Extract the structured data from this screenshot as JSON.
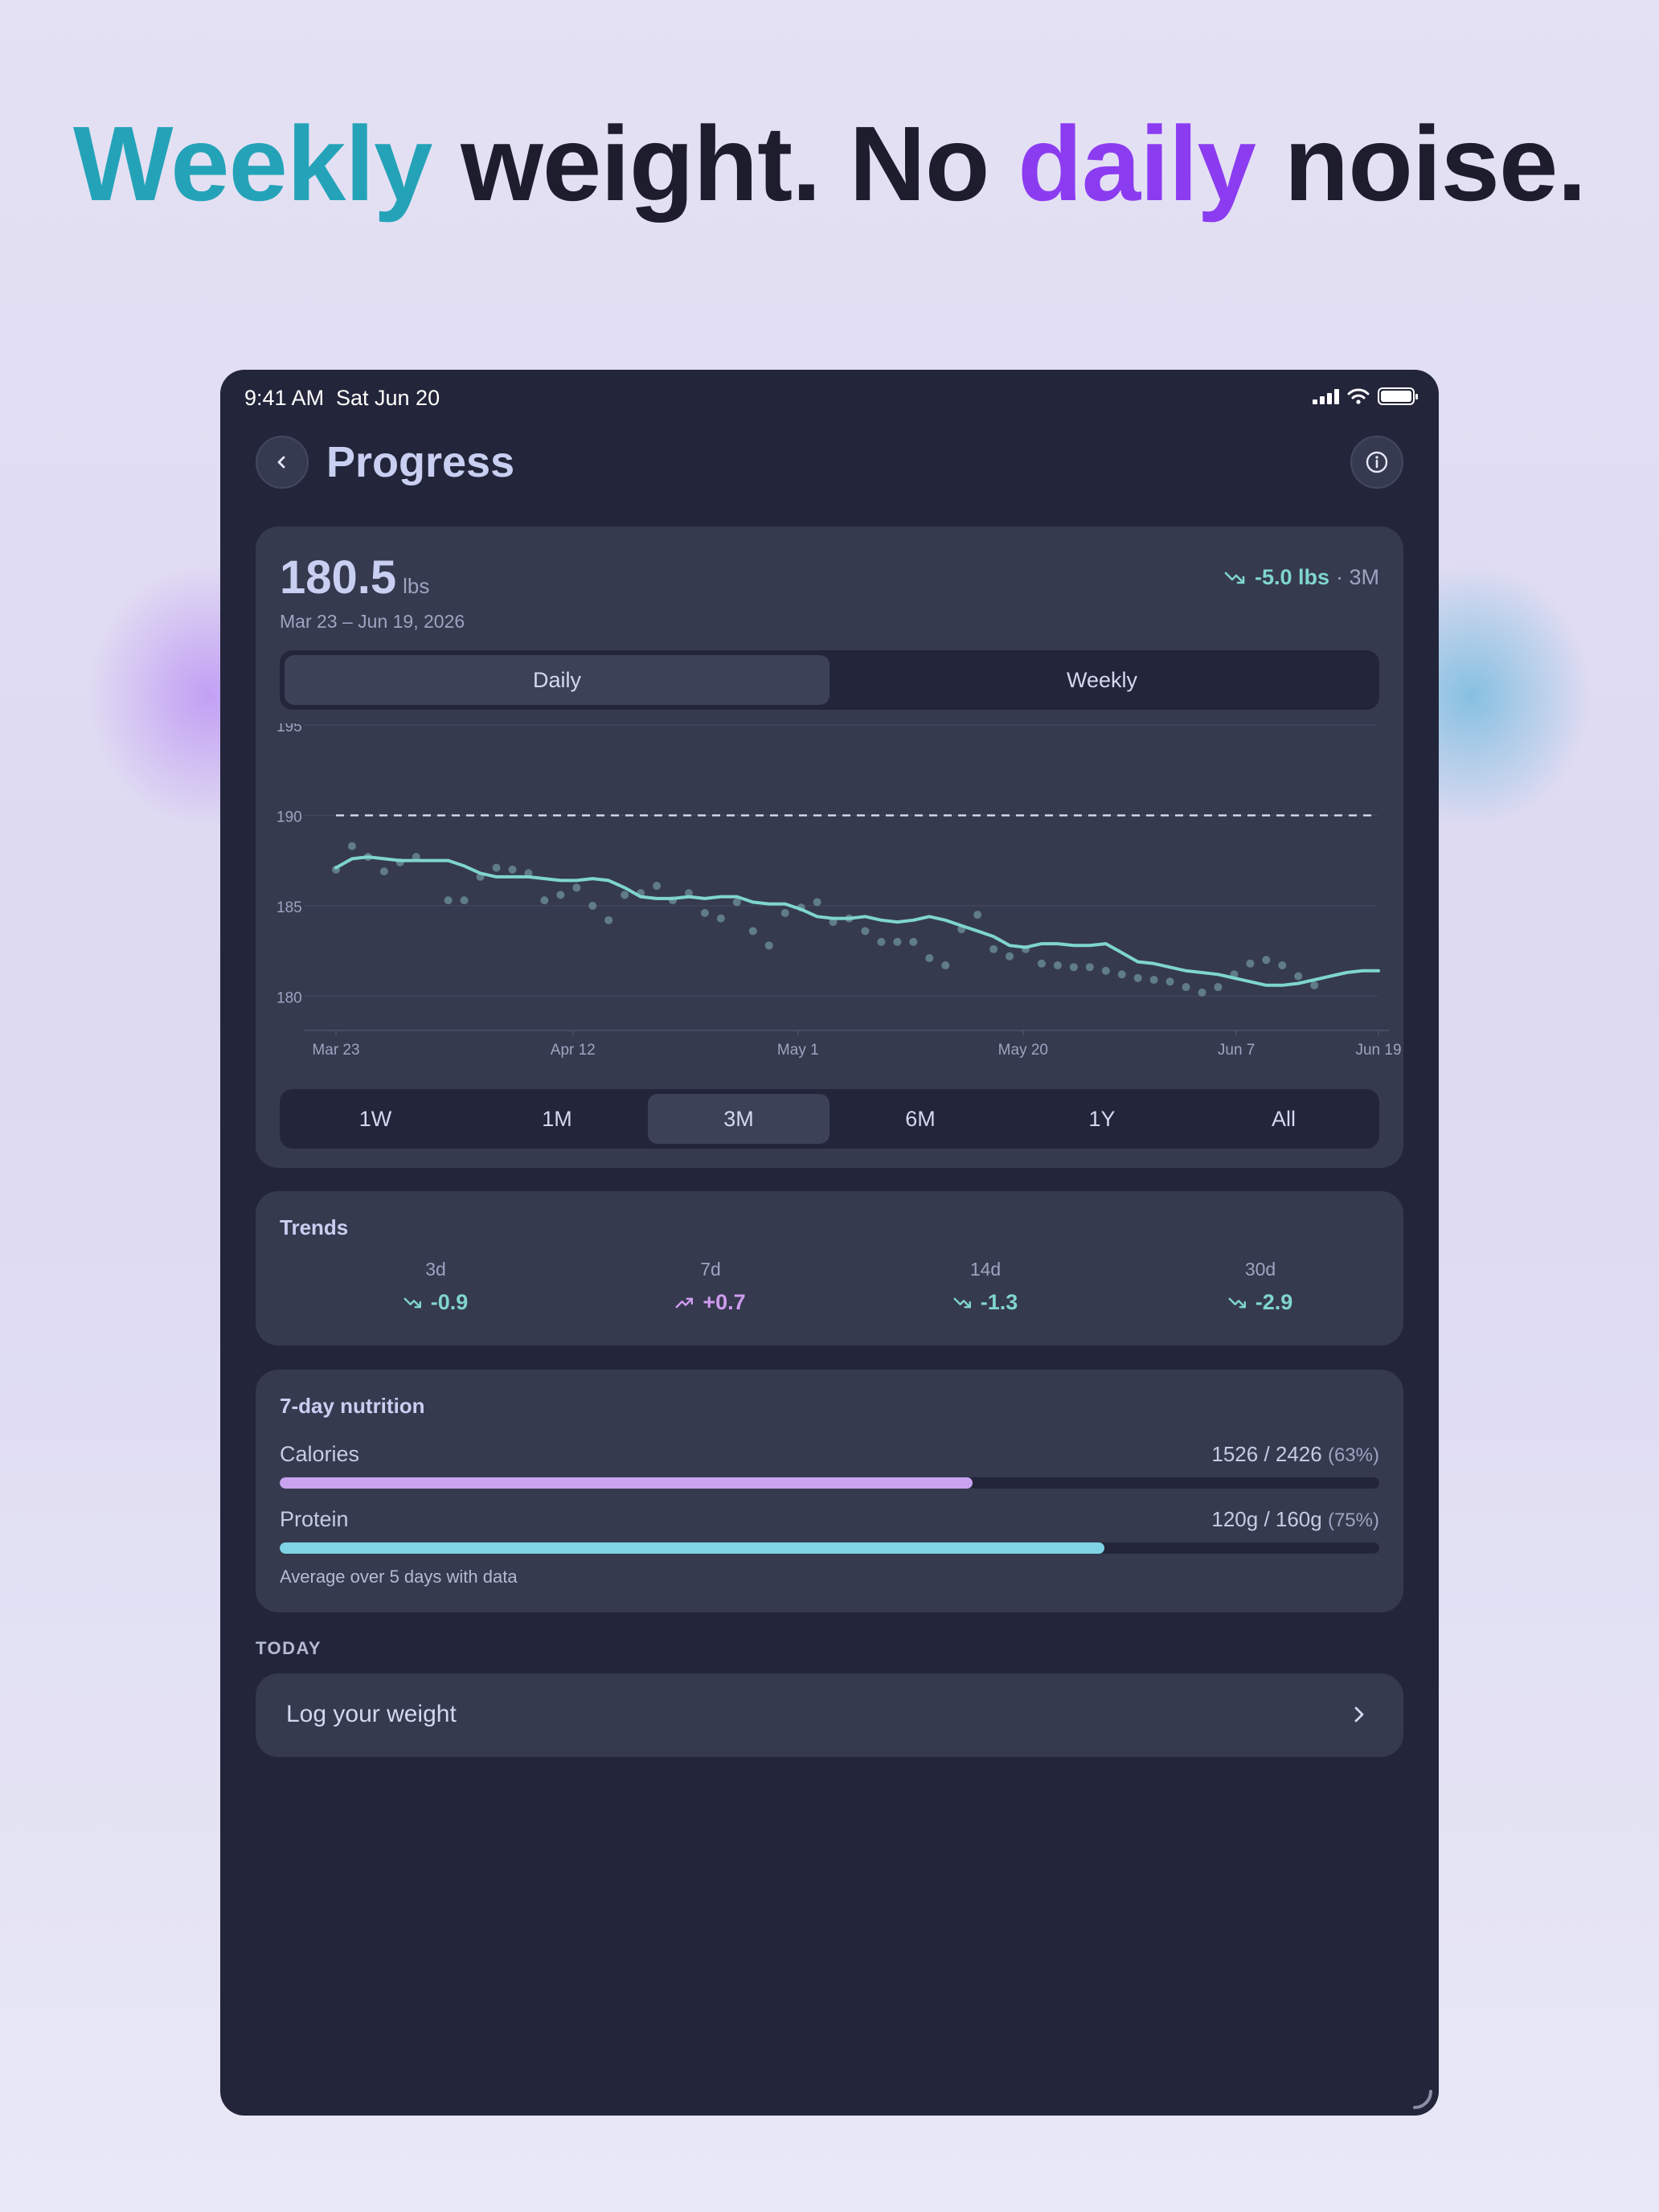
{
  "headline": {
    "word1": "Weekly",
    "word2": "weight. No",
    "word3": "daily",
    "word4": "noise."
  },
  "status_bar": {
    "time": "9:41 AM",
    "date": "Sat Jun 20",
    "icons": [
      "signal-icon",
      "wifi-icon",
      "battery-icon"
    ]
  },
  "header": {
    "back_icon": "chevron-left-icon",
    "title": "Progress",
    "info_icon": "info-icon"
  },
  "summary": {
    "weight": "180.5",
    "unit": "lbs",
    "date_range": "Mar 23 – Jun 19, 2026",
    "change": "-5.0 lbs",
    "change_period": "· 3M",
    "change_icon": "trending-down-icon"
  },
  "view_toggle": {
    "options": [
      "Daily",
      "Weekly"
    ],
    "selected": "Daily"
  },
  "range_selector": {
    "options": [
      "1W",
      "1M",
      "3M",
      "6M",
      "1Y",
      "All"
    ],
    "selected": "3M"
  },
  "chart_data": {
    "type": "line",
    "title": "",
    "xlabel": "",
    "ylabel": "",
    "x_start": "Mar 23",
    "x_end": "Jun 19",
    "x_tick_labels": [
      "Mar 23",
      "Apr 12",
      "May 1",
      "May 20",
      "Jun 7",
      "Jun 19"
    ],
    "y_tick_labels": [
      "195",
      "190",
      "185",
      "180"
    ],
    "ylim": [
      178.1,
      195
    ],
    "grid": true,
    "goal_line": 190,
    "series": [
      {
        "kind": "trend-line",
        "color": "#7fd6cc",
        "points": [
          [
            0,
            187.1
          ],
          [
            1,
            187.6
          ],
          [
            2,
            187.7
          ],
          [
            3,
            187.6
          ],
          [
            4,
            187.5
          ],
          [
            5,
            187.5
          ],
          [
            6,
            187.5
          ],
          [
            7,
            187.5
          ],
          [
            8,
            187.2
          ],
          [
            9,
            186.8
          ],
          [
            10,
            186.6
          ],
          [
            11,
            186.6
          ],
          [
            12,
            186.6
          ],
          [
            13,
            186.5
          ],
          [
            14,
            186.4
          ],
          [
            15,
            186.4
          ],
          [
            16,
            186.5
          ],
          [
            17,
            186.4
          ],
          [
            18,
            186.0
          ],
          [
            19,
            185.5
          ],
          [
            20,
            185.4
          ],
          [
            21,
            185.4
          ],
          [
            22,
            185.5
          ],
          [
            23,
            185.4
          ],
          [
            24,
            185.5
          ],
          [
            25,
            185.5
          ],
          [
            26,
            185.2
          ],
          [
            27,
            185.1
          ],
          [
            28,
            185.1
          ],
          [
            29,
            184.8
          ],
          [
            30,
            184.4
          ],
          [
            31,
            184.3
          ],
          [
            32,
            184.3
          ],
          [
            33,
            184.4
          ],
          [
            34,
            184.2
          ],
          [
            35,
            184.1
          ],
          [
            36,
            184.2
          ],
          [
            37,
            184.4
          ],
          [
            38,
            184.2
          ],
          [
            39,
            183.9
          ],
          [
            40,
            183.6
          ],
          [
            41,
            183.3
          ],
          [
            42,
            182.8
          ],
          [
            43,
            182.7
          ],
          [
            44,
            182.9
          ],
          [
            45,
            182.9
          ],
          [
            46,
            182.8
          ],
          [
            47,
            182.8
          ],
          [
            48,
            182.9
          ],
          [
            49,
            182.4
          ],
          [
            50,
            181.9
          ],
          [
            51,
            181.8
          ],
          [
            52,
            181.6
          ],
          [
            53,
            181.4
          ],
          [
            54,
            181.3
          ],
          [
            55,
            181.2
          ],
          [
            56,
            181.0
          ],
          [
            57,
            180.8
          ],
          [
            58,
            180.6
          ],
          [
            59,
            180.6
          ],
          [
            60,
            180.7
          ],
          [
            61,
            180.9
          ],
          [
            62,
            181.1
          ],
          [
            63,
            181.3
          ],
          [
            64,
            181.4
          ],
          [
            65,
            181.4
          ]
        ]
      },
      {
        "kind": "daily-points",
        "color": "#67898f",
        "points": [
          [
            0,
            187.0
          ],
          [
            1,
            188.3
          ],
          [
            2,
            187.7
          ],
          [
            3,
            186.9
          ],
          [
            4,
            187.4
          ],
          [
            5,
            187.7
          ],
          [
            7,
            185.3
          ],
          [
            8,
            185.3
          ],
          [
            9,
            186.6
          ],
          [
            10,
            187.1
          ],
          [
            11,
            187.0
          ],
          [
            12,
            186.8
          ],
          [
            13,
            185.3
          ],
          [
            14,
            185.6
          ],
          [
            15,
            186.0
          ],
          [
            16,
            185.0
          ],
          [
            17,
            184.2
          ],
          [
            18,
            185.6
          ],
          [
            19,
            185.7
          ],
          [
            20,
            186.1
          ],
          [
            21,
            185.3
          ],
          [
            22,
            185.7
          ],
          [
            23,
            184.6
          ],
          [
            24,
            184.3
          ],
          [
            25,
            185.2
          ],
          [
            26,
            183.6
          ],
          [
            27,
            182.8
          ],
          [
            28,
            184.6
          ],
          [
            29,
            184.9
          ],
          [
            30,
            185.2
          ],
          [
            31,
            184.1
          ],
          [
            32,
            184.3
          ],
          [
            33,
            183.6
          ],
          [
            34,
            183.0
          ],
          [
            35,
            183.0
          ],
          [
            36,
            183.0
          ],
          [
            37,
            182.1
          ],
          [
            38,
            181.7
          ],
          [
            39,
            183.7
          ],
          [
            40,
            184.5
          ],
          [
            41,
            182.6
          ],
          [
            42,
            182.2
          ],
          [
            43,
            182.6
          ],
          [
            44,
            181.8
          ],
          [
            45,
            181.7
          ],
          [
            46,
            181.6
          ],
          [
            47,
            181.6
          ],
          [
            48,
            181.4
          ],
          [
            49,
            181.2
          ],
          [
            50,
            181.0
          ],
          [
            51,
            180.9
          ],
          [
            52,
            180.8
          ],
          [
            53,
            180.5
          ],
          [
            54,
            180.2
          ],
          [
            55,
            180.5
          ],
          [
            56,
            181.2
          ],
          [
            57,
            181.8
          ],
          [
            58,
            182.0
          ],
          [
            59,
            181.7
          ],
          [
            60,
            181.1
          ],
          [
            61,
            180.6
          ]
        ]
      }
    ]
  },
  "trends": {
    "title": "Trends",
    "items": [
      {
        "period": "3d",
        "value": "-0.9",
        "direction": "down",
        "icon": "trending-down-icon"
      },
      {
        "period": "7d",
        "value": "+0.7",
        "direction": "up",
        "icon": "trending-up-icon"
      },
      {
        "period": "14d",
        "value": "-1.3",
        "direction": "down",
        "icon": "trending-down-icon"
      },
      {
        "period": "30d",
        "value": "-2.9",
        "direction": "down",
        "icon": "trending-down-icon"
      }
    ]
  },
  "nutrition": {
    "title": "7-day nutrition",
    "calories": {
      "label": "Calories",
      "value": "1526 / 2426",
      "pct_text": "(63%)",
      "fraction": 0.63,
      "color": "#c9a3f0"
    },
    "protein": {
      "label": "Protein",
      "value": "120g / 160g",
      "pct_text": "(75%)",
      "fraction": 0.75,
      "color": "#7fd3e5"
    },
    "footnote": "Average over 5 days with data"
  },
  "today": {
    "section_label": "TODAY",
    "log_label": "Log your weight",
    "chevron_icon": "chevron-right-icon"
  },
  "colors": {
    "teal_accent": "#24a3b8",
    "purple_accent": "#8b3cf0",
    "trend_down": "#7fd6cc",
    "trend_up": "#cf9bf0",
    "panel": "#363a4f",
    "background_dark": "#23263a"
  }
}
